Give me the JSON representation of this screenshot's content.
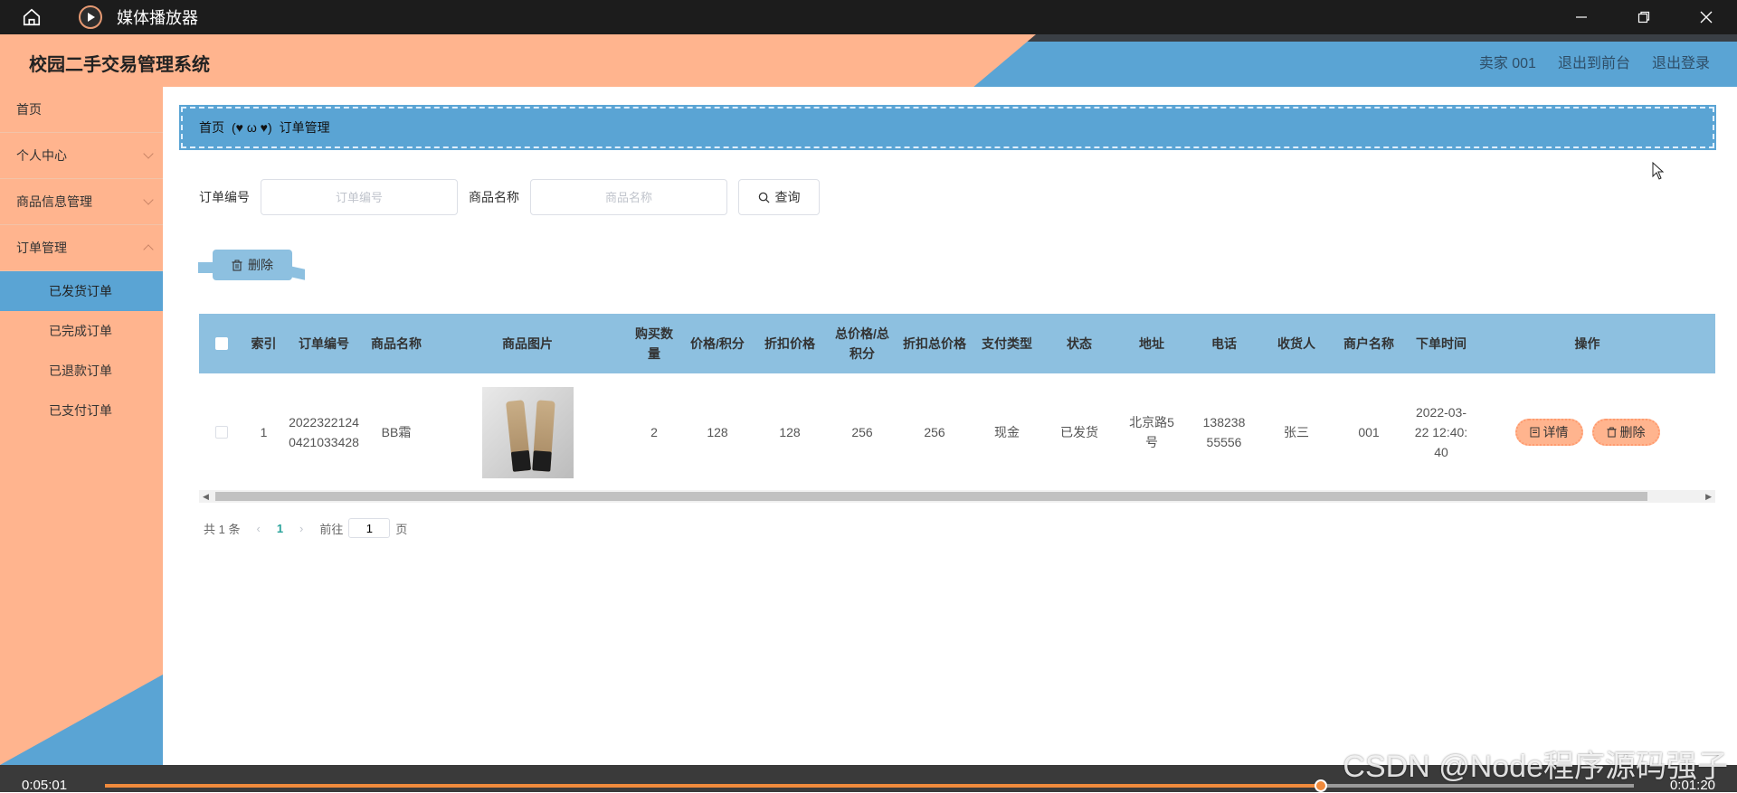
{
  "player": {
    "title": "媒体播放器",
    "time_elapsed": "0:05:01",
    "time_remaining": "0:01:20",
    "progress": 0.795
  },
  "app": {
    "title": "校园二手交易管理系统",
    "user_label": "卖家 001",
    "front_label": "退出到前台",
    "logout_label": "退出登录"
  },
  "sidebar": {
    "items": [
      {
        "label": "首页"
      },
      {
        "label": "个人中心"
      },
      {
        "label": "商品信息管理"
      },
      {
        "label": "订单管理"
      }
    ],
    "sub_items": [
      {
        "label": "已发货订单"
      },
      {
        "label": "已完成订单"
      },
      {
        "label": "已退款订单"
      },
      {
        "label": "已支付订单"
      }
    ]
  },
  "breadcrumb": {
    "home": "首页",
    "separator": "(♥ ω ♥)",
    "current": "订单管理"
  },
  "search": {
    "order_label": "订单编号",
    "order_placeholder": "订单编号",
    "product_label": "商品名称",
    "product_placeholder": "商品名称",
    "button": "查询"
  },
  "toolbar": {
    "delete_label": "删除"
  },
  "table": {
    "headers": [
      "索引",
      "订单编号",
      "商品名称",
      "商品图片",
      "购买数量",
      "价格/积分",
      "折扣价格",
      "总价格/总积分",
      "折扣总价格",
      "支付类型",
      "状态",
      "地址",
      "电话",
      "收货人",
      "商户名称",
      "下单时间",
      "操作"
    ],
    "rows": [
      {
        "index": "1",
        "order_no": "20223221240421033428",
        "product_name": "BB霜",
        "quantity": "2",
        "price": "128",
        "discount_price": "128",
        "total": "256",
        "discount_total": "256",
        "pay_type": "现金",
        "status": "已发货",
        "address": "北京路5号",
        "phone": "13823855556",
        "receiver": "张三",
        "merchant": "001",
        "order_time": "2022-03-22 12:40:40",
        "detail_label": "详情",
        "delete_label": "删除"
      }
    ]
  },
  "pagination": {
    "total_text": "共 1 条",
    "current_page": "1",
    "goto_label": "前往",
    "goto_value": "1",
    "page_suffix": "页"
  },
  "watermark": "CSDN @Node程序源码强子"
}
